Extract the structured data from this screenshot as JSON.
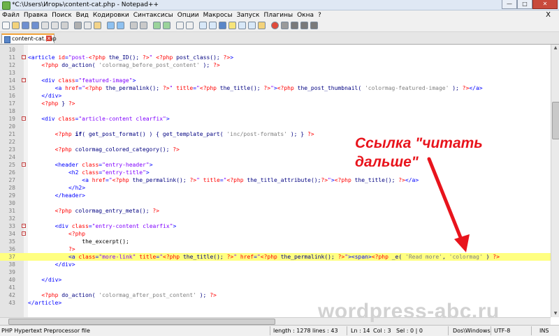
{
  "window": {
    "title": "*C:\\Users\\Игорь\\content-cat.php - Notepad++",
    "controls": {
      "minimize": "—",
      "maximize": "□",
      "close": "✕"
    }
  },
  "menu": [
    "Файл",
    "Правка",
    "Поиск",
    "Вид",
    "Кодировки",
    "Синтаксисы",
    "Опции",
    "Макросы",
    "Запуск",
    "Плагины",
    "Окна",
    "?"
  ],
  "menu_close": "X",
  "tab": {
    "label": "content-cat.php",
    "close": "x"
  },
  "editor": {
    "current_line": "37",
    "lines": [
      {
        "n": "10",
        "code": ""
      },
      {
        "n": "11",
        "code": "<article id=\"post-<?php the_ID(); ?>\" <?php post_class(); ?>>"
      },
      {
        "n": "12",
        "code": "    <?php do_action( 'colormag_before_post_content' ); ?>"
      },
      {
        "n": "13",
        "code": ""
      },
      {
        "n": "14",
        "code": "    <div class=\"featured-image\">"
      },
      {
        "n": "15",
        "code": "        <a href=\"<?php the_permalink(); ?>\" title=\"<?php the_title(); ?>\"><?php the_post_thumbnail( 'colormag-featured-image' ); ?></a>"
      },
      {
        "n": "16",
        "code": "    </div>"
      },
      {
        "n": "17",
        "code": "    <?php } ?>"
      },
      {
        "n": "18",
        "code": ""
      },
      {
        "n": "19",
        "code": "    <div class=\"article-content clearfix\">"
      },
      {
        "n": "20",
        "code": ""
      },
      {
        "n": "21",
        "code": "        <?php if( get_post_format() ) { get_template_part( 'inc/post-formats' ); } ?>"
      },
      {
        "n": "22",
        "code": ""
      },
      {
        "n": "23",
        "code": "        <?php colormag_colored_category(); ?>"
      },
      {
        "n": "24",
        "code": ""
      },
      {
        "n": "25",
        "code": "        <header class=\"entry-header\">"
      },
      {
        "n": "26",
        "code": "            <h2 class=\"entry-title\">"
      },
      {
        "n": "27",
        "code": "                <a href=\"<?php the_permalink(); ?>\" title=\"<?php the_title_attribute();?>\"><?php the_title(); ?></a>"
      },
      {
        "n": "28",
        "code": "            </h2>"
      },
      {
        "n": "29",
        "code": "        </header>"
      },
      {
        "n": "30",
        "code": ""
      },
      {
        "n": "31",
        "code": "        <?php colormag_entry_meta(); ?>"
      },
      {
        "n": "32",
        "code": ""
      },
      {
        "n": "33",
        "code": "        <div class=\"entry-content clearfix\">"
      },
      {
        "n": "34",
        "code": "            <?php"
      },
      {
        "n": "35",
        "code": "                the_excerpt();"
      },
      {
        "n": "36",
        "code": "            ?>"
      },
      {
        "n": "37",
        "code": "            <a class=\"more-link\" title=\"<?php the_title(); ?>\" href=\"<?php the_permalink(); ?>\"><span><?php _e( 'Read more', 'colormag' ) ?>"
      },
      {
        "n": "38",
        "code": "        </div>"
      },
      {
        "n": "39",
        "code": ""
      },
      {
        "n": "40",
        "code": "    </div>"
      },
      {
        "n": "41",
        "code": ""
      },
      {
        "n": "42",
        "code": "    <?php do_action( 'colormag_after_post_content' ); ?>"
      },
      {
        "n": "43",
        "code": "</article>"
      }
    ]
  },
  "status": {
    "filetype": "PHP Hypertext Preprocessor file",
    "length": "length : 1278",
    "lines": "lines : 43",
    "ln": "Ln : 14",
    "col": "Col : 3",
    "sel": "Sel : 0 | 0",
    "eol": "Dos\\Windows",
    "encoding": "UTF-8",
    "mode": "INS"
  },
  "annotation": "Ссылка \"читать\nдальше\"",
  "watermark": "wordpress-abc.ru",
  "colors": {
    "tag": "#0000ff",
    "attr": "#ff0000",
    "string": "#8000ff",
    "php": "#ff0000",
    "php_text": "#000080",
    "php_string": "#808080",
    "current_line": "#ffff80",
    "annotation": "#e8141c",
    "tab_accent": "#f2a33a"
  },
  "icons": [
    "new-file-icon",
    "open-folder-icon",
    "save-icon",
    "save-all-icon",
    "close-icon",
    "close-all-icon",
    "print-icon",
    "cut-icon",
    "copy-icon",
    "paste-icon",
    "undo-icon",
    "redo-icon",
    "find-icon",
    "replace-icon",
    "zoom-in-icon",
    "zoom-out-icon",
    "sync-v-icon",
    "sync-h-icon",
    "wrap-icon",
    "indent-guide-icon",
    "show-all-icon",
    "lang-icon",
    "doc-map-icon",
    "function-list-icon",
    "folder-workspace-icon",
    "record-macro-icon",
    "stop-macro-icon",
    "play-macro-icon",
    "run-macro-multiple-icon",
    "save-macro-icon"
  ]
}
